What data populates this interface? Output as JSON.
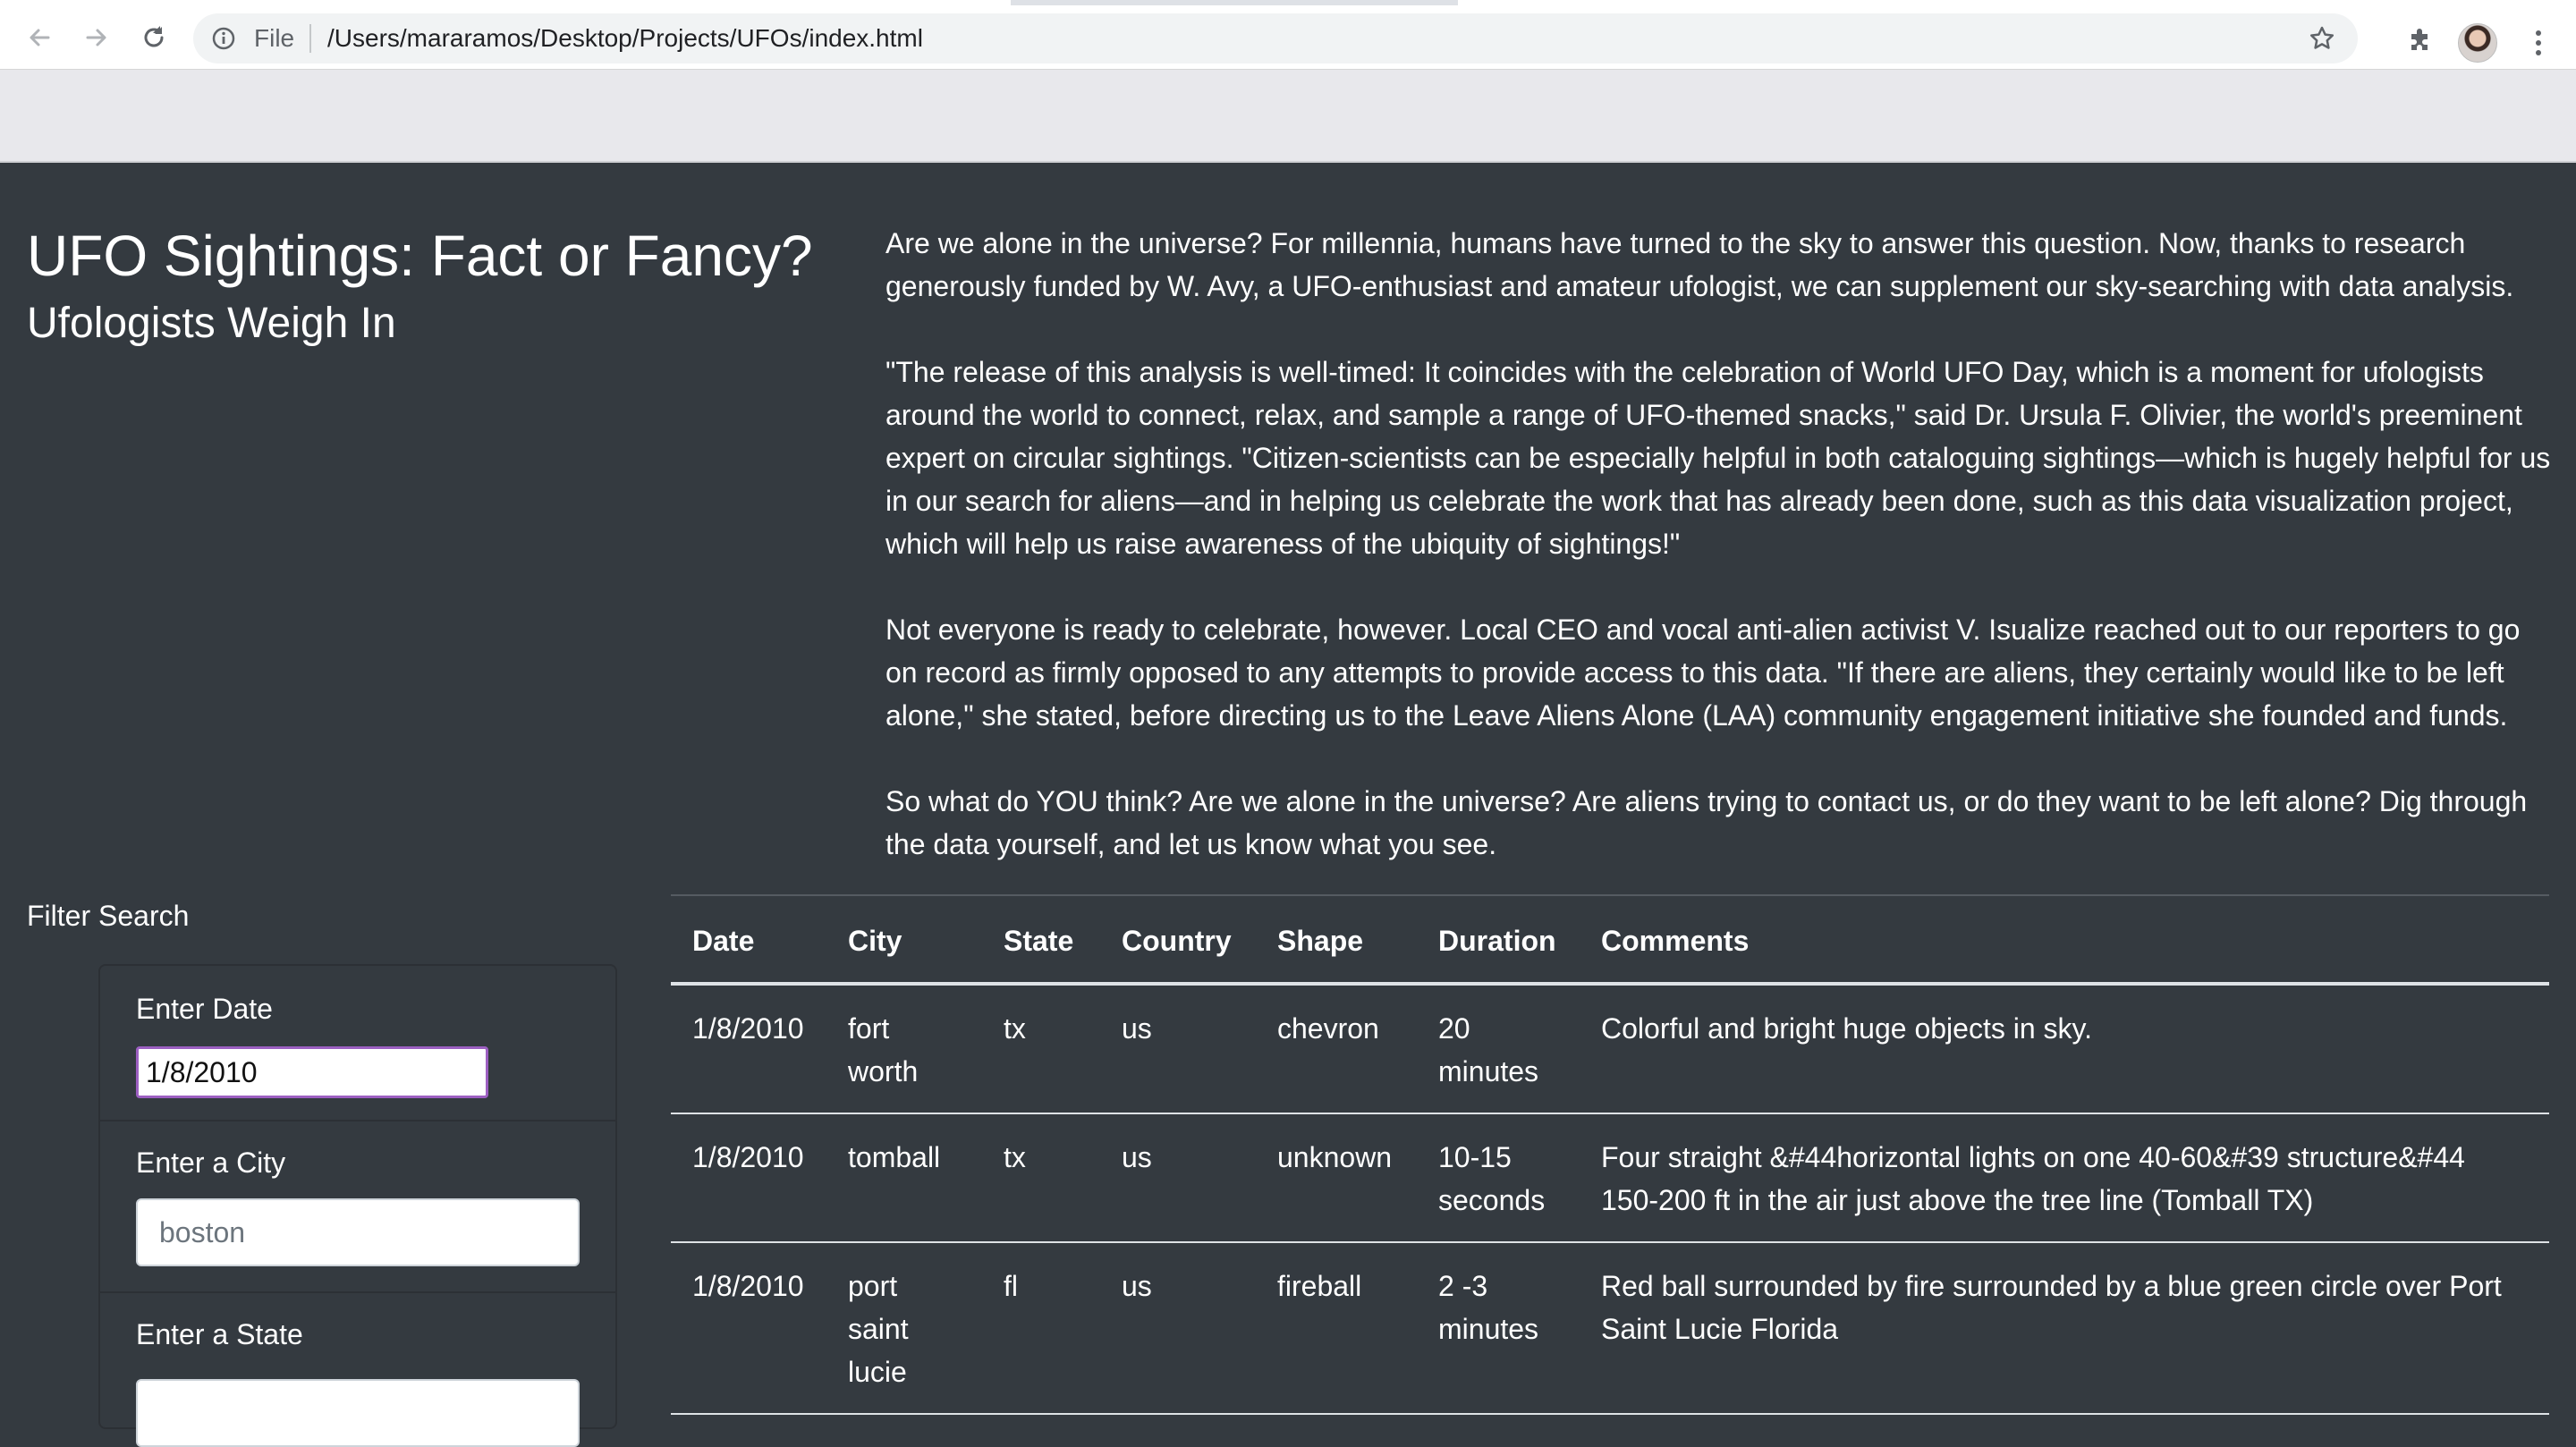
{
  "browser": {
    "scheme_label": "File",
    "url": "/Users/mararamos/Desktop/Projects/UFOs/index.html",
    "icons": [
      "back-icon",
      "forward-icon",
      "reload-icon",
      "info-icon",
      "star-icon",
      "puzzle-icon",
      "kebab-icon"
    ]
  },
  "header": {
    "title": "UFO Sightings: Fact or Fancy?",
    "subtitle": "Ufologists Weigh In"
  },
  "article": {
    "paragraphs": [
      "Are we alone in the universe? For millennia, humans have turned to the sky to answer this question. Now, thanks to research generously funded by W. Avy, a UFO-enthusiast and amateur ufologist, we can supplement our sky-searching with data analysis.",
      "\"The release of this analysis is well-timed: It coincides with the celebration of World UFO Day, which is a moment for ufologists around the world to connect, relax, and sample a range of UFO-themed snacks,\" said Dr. Ursula F. Olivier, the world's preeminent expert on circular sightings. \"Citizen-scientists can be especially helpful in both cataloguing sightings—which is hugely helpful for us in our search for aliens—and in helping us celebrate the work that has already been done, such as this data visualization project, which will help us raise awareness of the ubiquity of sightings!\"",
      "Not everyone is ready to celebrate, however. Local CEO and vocal anti-alien activist V. Isualize reached out to our reporters to go on record as firmly opposed to any attempts to provide access to this data. \"If there are aliens, they certainly would like to be left alone,\" she stated, before directing us to the Leave Aliens Alone (LAA) community engagement initiative she founded and funds.",
      "So what do YOU think? Are we alone in the universe? Are aliens trying to contact us, or do they want to be left alone? Dig through the data yourself, and let us know what you see."
    ]
  },
  "filters": {
    "title": "Filter Search",
    "date": {
      "label": "Enter Date",
      "value": "1/8/2010"
    },
    "city": {
      "label": "Enter a City",
      "placeholder": "boston"
    },
    "state": {
      "label": "Enter a State"
    }
  },
  "table": {
    "headers": [
      "Date",
      "City",
      "State",
      "Country",
      "Shape",
      "Duration",
      "Comments"
    ],
    "rows": [
      [
        "1/8/2010",
        "fort worth",
        "tx",
        "us",
        "chevron",
        "20 minutes",
        "Colorful and bright huge objects in sky."
      ],
      [
        "1/8/2010",
        "tomball",
        "tx",
        "us",
        "unknown",
        "10-15 seconds",
        "Four straight &#44horizontal lights on one 40-60&#39 structure&#44 150-200 ft in the air just above the tree line (Tomball TX)"
      ],
      [
        "1/8/2010",
        "port saint lucie",
        "fl",
        "us",
        "fireball",
        "2 -3 minutes",
        "Red ball surrounded by fire surrounded by a blue green circle over Port Saint Lucie Florida"
      ]
    ]
  }
}
